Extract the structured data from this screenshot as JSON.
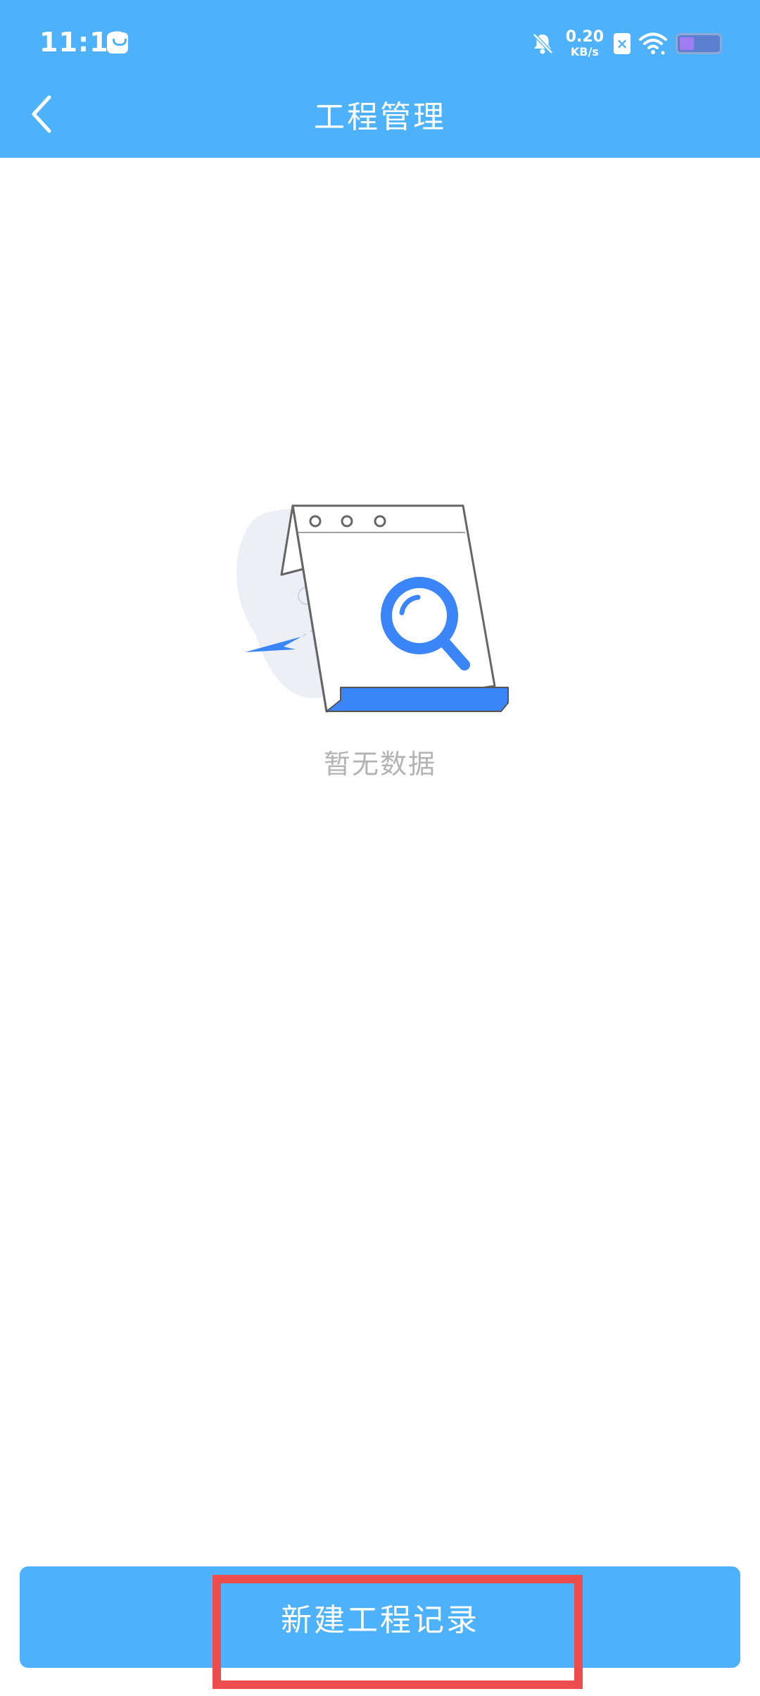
{
  "status_bar": {
    "time": "11:13",
    "net_speed_value": "0.20",
    "net_speed_unit": "KB/s",
    "icons": [
      "shopping-bag-icon",
      "bell-off-icon",
      "sim-x-icon",
      "wifi-icon",
      "battery-icon"
    ]
  },
  "header": {
    "title": "工程管理",
    "back_icon": "chevron-left-icon"
  },
  "empty_state": {
    "message": "暂无数据",
    "illustration": "empty-calendar-search-illustration"
  },
  "footer": {
    "new_button_label": "新建工程记录"
  },
  "colors": {
    "primary": "#4DB2FB",
    "accent_blue": "#3A86F8",
    "empty_text": "#B3B3B3",
    "highlight": "#EE4D4D"
  }
}
